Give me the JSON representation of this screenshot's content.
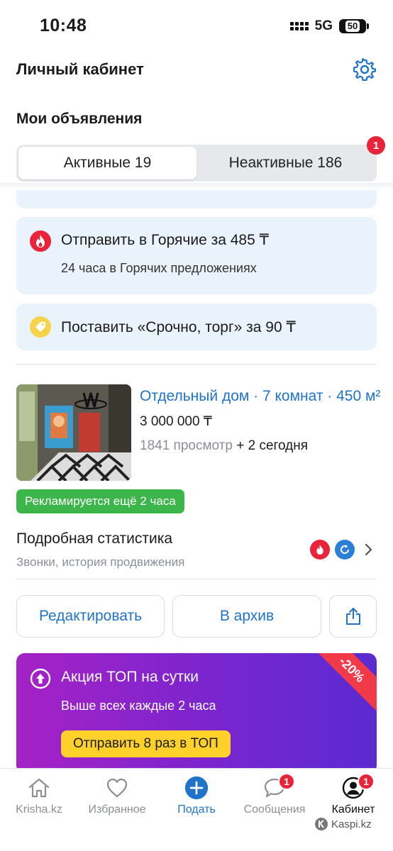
{
  "status_bar": {
    "time": "10:48",
    "network": "5G",
    "battery": "50"
  },
  "header": {
    "title": "Личный кабинет"
  },
  "section": {
    "title": "Мои объявления"
  },
  "tabs": [
    {
      "label": "Активные 19",
      "active": true
    },
    {
      "label": "Неактивные 186",
      "active": false,
      "badge": "1"
    }
  ],
  "promos": [
    {
      "icon": "fire-icon",
      "title": "Отправить в Горячие за 485 ₸",
      "subtitle": "24 часа в Горячих предложениях"
    },
    {
      "icon": "price-tag-icon",
      "title": "Поставить «Срочно, торг» за 90 ₸"
    }
  ],
  "listing": {
    "title": "Отдельный дом · 7 комнат · 450 м²",
    "price": "3 000 000 ₸",
    "views": "1841 просмотр",
    "views_today": "+ 2 сегодня",
    "ad_badge": "Рекламируется ещё 2 часа"
  },
  "stats": {
    "title": "Подробная статистика",
    "subtitle": "Звонки, история продвижения"
  },
  "actions": {
    "edit": "Редактировать",
    "archive": "В архив"
  },
  "top_banner": {
    "title": "Акция ТОП на сутки",
    "subtitle": "Выше всех каждые 2 часа",
    "button": "Отправить 8 раз в ТОП",
    "discount": "-20%"
  },
  "tabbar": [
    {
      "label": "Krisha.kz",
      "icon": "home-icon"
    },
    {
      "label": "Избранное",
      "icon": "heart-icon"
    },
    {
      "label": "Подать",
      "icon": "plus-icon",
      "active": true
    },
    {
      "label": "Сообщения",
      "icon": "chat-icon",
      "badge": "1"
    },
    {
      "label": "Кабинет",
      "icon": "profile-icon",
      "badge": "1"
    }
  ],
  "watermark": "Kaspi.kz",
  "colors": {
    "accent": "#1f73c8",
    "hot": "#e8233a",
    "urgent": "#f7d34a",
    "ad_green": "#3cb54a",
    "banner_start": "#a522c6",
    "banner_end": "#5a2bd0"
  }
}
